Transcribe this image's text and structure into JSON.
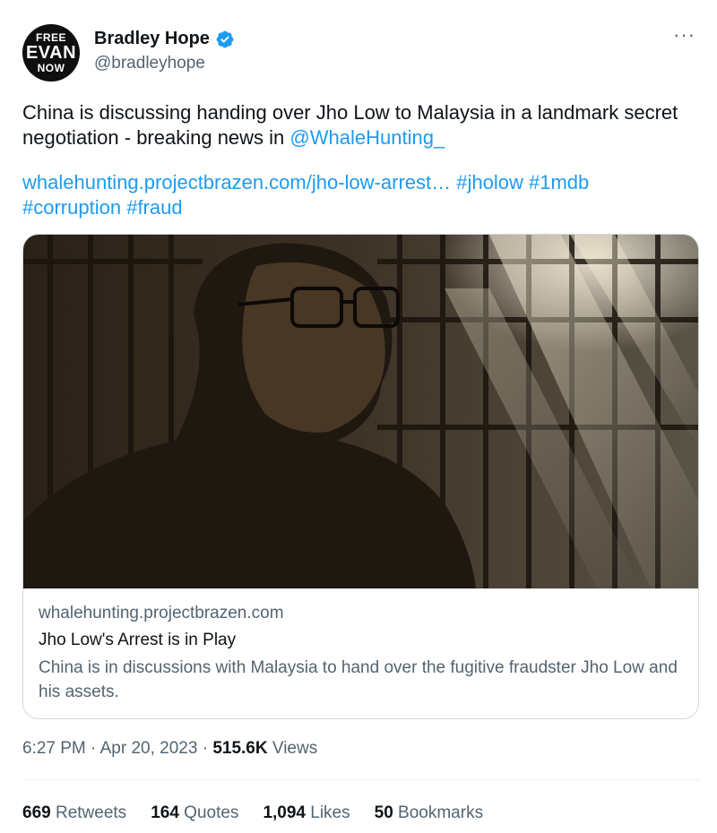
{
  "avatar": {
    "line1": "FREE",
    "line2": "EVAN",
    "line3": "NOW"
  },
  "author": {
    "display_name": "Bradley Hope",
    "handle": "@bradleyhope"
  },
  "tweet": {
    "text": "China is discussing handing over Jho Low to Malaysia in a landmark secret negotiation - breaking news in ",
    "mention": "@WhaleHunting_",
    "url": "whalehunting.projectbrazen.com/jho-low-arrest…",
    "hashtags": [
      "#jholow",
      "#1mdb",
      "#corruption",
      "#fraud"
    ]
  },
  "card": {
    "domain": "whalehunting.projectbrazen.com",
    "title": "Jho Low's Arrest is in Play",
    "description": "China is in discussions with Malaysia to hand over the fugitive fraudster Jho Low and his assets."
  },
  "meta": {
    "time": "6:27 PM",
    "date": "Apr 20, 2023",
    "views_count": "515.6K",
    "views_label": "Views"
  },
  "stats": [
    {
      "count": "669",
      "label": "Retweets"
    },
    {
      "count": "164",
      "label": "Quotes"
    },
    {
      "count": "1,094",
      "label": "Likes"
    },
    {
      "count": "50",
      "label": "Bookmarks"
    }
  ],
  "icons": {
    "more": "more-horizontal-icon",
    "verified": "verified-badge-icon"
  },
  "colors": {
    "link": "#1d9bf0",
    "secondary_text": "#536471",
    "primary_text": "#0f1419",
    "border": "#cfd9de"
  }
}
